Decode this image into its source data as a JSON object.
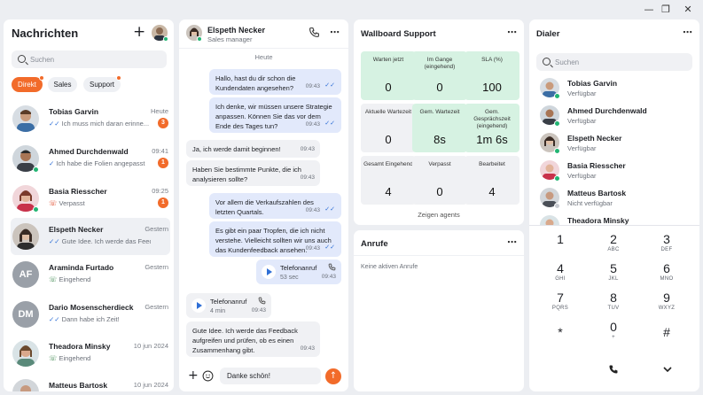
{
  "window": {
    "min": "—",
    "max": "❐",
    "close": "✕"
  },
  "messages": {
    "title": "Nachrichten",
    "search_placeholder": "Suchen",
    "filters": [
      "Direkt",
      "Sales",
      "Support"
    ],
    "conversations": [
      {
        "name": "Tobias Garvin",
        "preview": "Ich muss mich daran erinne...",
        "time": "Heute",
        "badge": "3",
        "status": "read"
      },
      {
        "name": "Ahmed Durchdenwald",
        "preview": "Ich habe die Folien angepasst",
        "time": "09:41",
        "badge": "1",
        "status": "read"
      },
      {
        "name": "Basia Riesscher",
        "preview": "Verpasst",
        "time": "09:25",
        "badge": "1",
        "status": "missed"
      },
      {
        "name": "Elspeth Necker",
        "preview": "Gute Idee. Ich werde das Feedback",
        "time": "Gestern",
        "badge": "",
        "status": "read"
      },
      {
        "name": "Araminda Furtado",
        "preview": "Eingehend",
        "time": "Gestern",
        "badge": "",
        "status": "incoming",
        "initials": "AF"
      },
      {
        "name": "Dario Mosenscherdieck",
        "preview": "Dann habe ich Zeit!",
        "time": "Gestern",
        "badge": "",
        "status": "read",
        "initials": "DM"
      },
      {
        "name": "Theadora Minsky",
        "preview": "Eingehend",
        "time": "10 jun 2024",
        "badge": "",
        "status": "incoming"
      },
      {
        "name": "Matteus Bartosk",
        "preview": "Eingehend",
        "time": "10 jun 2024",
        "badge": "",
        "status": "incoming"
      }
    ]
  },
  "chat": {
    "contact": "Elspeth Necker",
    "role": "Sales manager",
    "day": "Heute",
    "messages": [
      {
        "dir": "out",
        "lines": [
          "Hallo, hast du dir schon die",
          "Kundendaten angesehen?"
        ],
        "time": "09:43"
      },
      {
        "dir": "out",
        "lines": [
          "Ich denke, wir müssen unsere Strategie",
          "anpassen. Können Sie das vor dem",
          "Ende des Tages tun?"
        ],
        "time": "09:43"
      },
      {
        "dir": "in",
        "lines": [
          "Ja, ich werde damit beginnen!"
        ],
        "time": "09:43"
      },
      {
        "dir": "in",
        "lines": [
          "Haben Sie bestimmte Punkte, die ich",
          "analysieren sollte?"
        ],
        "time": "09:43"
      },
      {
        "dir": "out",
        "lines": [
          "Vor allem die Verkaufszahlen des",
          "letzten Quartals."
        ],
        "time": "09:43"
      },
      {
        "dir": "out",
        "lines": [
          "Es gibt ein paar Tropfen, die ich nicht",
          "verstehe. Vielleicht sollten wir uns auch",
          "das Kundenfeedback ansehen."
        ],
        "time": "09:43"
      },
      {
        "dir": "in",
        "lines": [
          "Gute Idee. Ich werde das Feedback",
          "aufgreifen und prüfen, ob es einen",
          "Zusammenhang gibt."
        ],
        "time": "09:43"
      }
    ],
    "call_out": {
      "label": "Telefonanruf",
      "duration": "53 sec",
      "time": "09:43"
    },
    "call_in": {
      "label": "Telefonanruf",
      "duration": "4 min",
      "time": "09:43"
    },
    "input_value": "Danke schön!"
  },
  "wallboard": {
    "title": "Wallboard Support",
    "tiles": [
      {
        "label": "Warten jetzt",
        "value": "0",
        "tone": "g"
      },
      {
        "label": "Im Gange (eingehend)",
        "value": "0",
        "tone": "g"
      },
      {
        "label": "SLA (%)",
        "value": "100",
        "tone": "g"
      },
      {
        "label": "Aktuelle Wartezeit",
        "value": "0",
        "tone": "w"
      },
      {
        "label": "Gem. Wartezeit",
        "value": "8s",
        "tone": "g"
      },
      {
        "label": "Gem. Gesprächszeit (eingehend)",
        "value": "1m 6s",
        "tone": "g"
      },
      {
        "label": "Gesamt Eingehend",
        "value": "4",
        "tone": "w"
      },
      {
        "label": "Verpasst",
        "value": "0",
        "tone": "w"
      },
      {
        "label": "Bearbeitet",
        "value": "4",
        "tone": "w"
      }
    ],
    "show_agents": "Zeigen agents"
  },
  "calls": {
    "title": "Anrufe",
    "empty": "Keine aktiven Anrufe"
  },
  "dialer": {
    "title": "Dialer",
    "search_placeholder": "Suchen",
    "contacts": [
      {
        "name": "Tobias Garvin",
        "status": "Verfügbar",
        "online": true
      },
      {
        "name": "Ahmed Durchdenwald",
        "status": "Verfügbar",
        "online": true
      },
      {
        "name": "Elspeth Necker",
        "status": "Verfügbar",
        "online": true
      },
      {
        "name": "Basia Riesscher",
        "status": "Verfügbar",
        "online": true
      },
      {
        "name": "Matteus Bartosk",
        "status": "Nicht verfügbar",
        "online": false
      },
      {
        "name": "Theadora Minsky",
        "status": "",
        "online": false
      }
    ],
    "keys": [
      {
        "d": "1",
        "l": ""
      },
      {
        "d": "2",
        "l": "ABC"
      },
      {
        "d": "3",
        "l": "DEF"
      },
      {
        "d": "4",
        "l": "GHI"
      },
      {
        "d": "5",
        "l": "JKL"
      },
      {
        "d": "6",
        "l": "MNO"
      },
      {
        "d": "7",
        "l": "PQRS"
      },
      {
        "d": "8",
        "l": "TUV"
      },
      {
        "d": "9",
        "l": "WXYZ"
      },
      {
        "d": "*",
        "l": ""
      },
      {
        "d": "0",
        "l": "+"
      },
      {
        "d": "#",
        "l": ""
      }
    ]
  },
  "colors": {
    "accent": "#f26b2a",
    "online": "#22b573",
    "bubble_out": "#e2e9fb",
    "tile_green": "#d6f2e2"
  }
}
